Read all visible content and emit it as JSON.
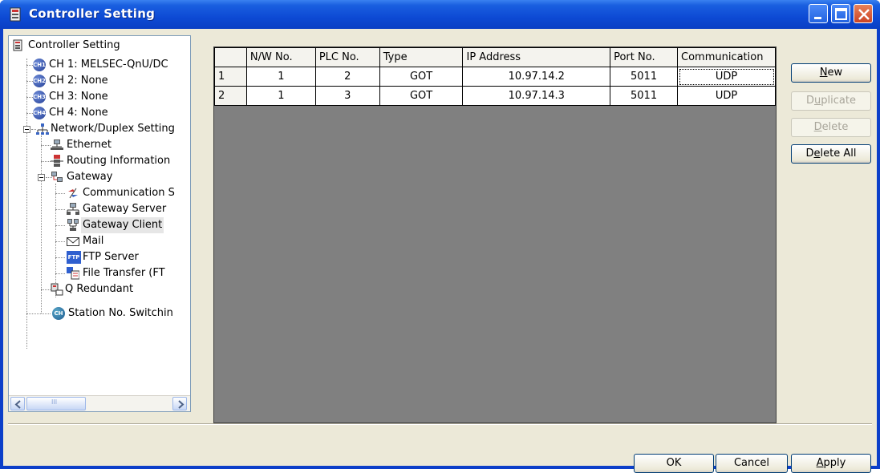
{
  "window": {
    "title": "Controller Setting",
    "controls": {
      "minimize": "minimize-icon",
      "maximize": "maximize-icon",
      "close": "close-icon"
    }
  },
  "tree": {
    "items": [
      {
        "label": "Controller Setting",
        "icon": "controller-icon"
      },
      {
        "label": "CH 1: MELSEC-QnU/DC",
        "icon": "channel-1-icon",
        "badge": "CH1"
      },
      {
        "label": "CH 2: None",
        "icon": "channel-2-icon",
        "badge": "CH2"
      },
      {
        "label": "CH 3: None",
        "icon": "channel-3-icon",
        "badge": "CH3"
      },
      {
        "label": "CH 4: None",
        "icon": "channel-4-icon",
        "badge": "CH4"
      },
      {
        "label": "Network/Duplex Setting",
        "icon": "network-icon"
      },
      {
        "label": "Ethernet",
        "icon": "ethernet-icon"
      },
      {
        "label": "Routing Information",
        "icon": "routing-icon"
      },
      {
        "label": "Gateway",
        "icon": "gateway-icon"
      },
      {
        "label": "Communication S",
        "icon": "communication-icon"
      },
      {
        "label": "Gateway Server",
        "icon": "gateway-server-icon"
      },
      {
        "label": "Gateway Client",
        "icon": "gateway-client-icon"
      },
      {
        "label": "Mail",
        "icon": "mail-icon"
      },
      {
        "label": "FTP Server",
        "icon": "ftp-icon",
        "badge": "FTP"
      },
      {
        "label": "File Transfer (FT",
        "icon": "file-transfer-icon"
      },
      {
        "label": "Q Redundant",
        "icon": "q-redundant-icon"
      },
      {
        "label": "Station No. Switchin",
        "icon": "station-switch-icon",
        "badge": "CH"
      }
    ],
    "selected": "Gateway Client",
    "scroll_thumb_text": "III"
  },
  "grid": {
    "columns": [
      "",
      "N/W No.",
      "PLC No.",
      "Type",
      "IP Address",
      "Port No.",
      "Communication"
    ],
    "rows": [
      [
        "1",
        "1",
        "2",
        "GOT",
        "10.97.14.2",
        "5011",
        "UDP"
      ],
      [
        "2",
        "1",
        "3",
        "GOT",
        "10.97.14.3",
        "5011",
        "UDP"
      ]
    ]
  },
  "buttons": {
    "new_prefix": "",
    "new_ul": "N",
    "new_suffix": "ew",
    "dup_prefix": "D",
    "dup_ul": "u",
    "dup_suffix": "plicate",
    "del_prefix": "",
    "del_ul": "D",
    "del_suffix": "elete",
    "delall_prefix": "D",
    "delall_ul": "e",
    "delall_suffix": "lete All",
    "ok": "OK",
    "cancel": "Cancel",
    "apply_prefix": "",
    "apply_ul": "A",
    "apply_suffix": "pply"
  },
  "colors": {
    "title_bar": "#0d4ad4",
    "dialog_bg": "#ece9d8",
    "grid_empty": "#808080",
    "selected_row_bg": "#e6e6e6"
  }
}
